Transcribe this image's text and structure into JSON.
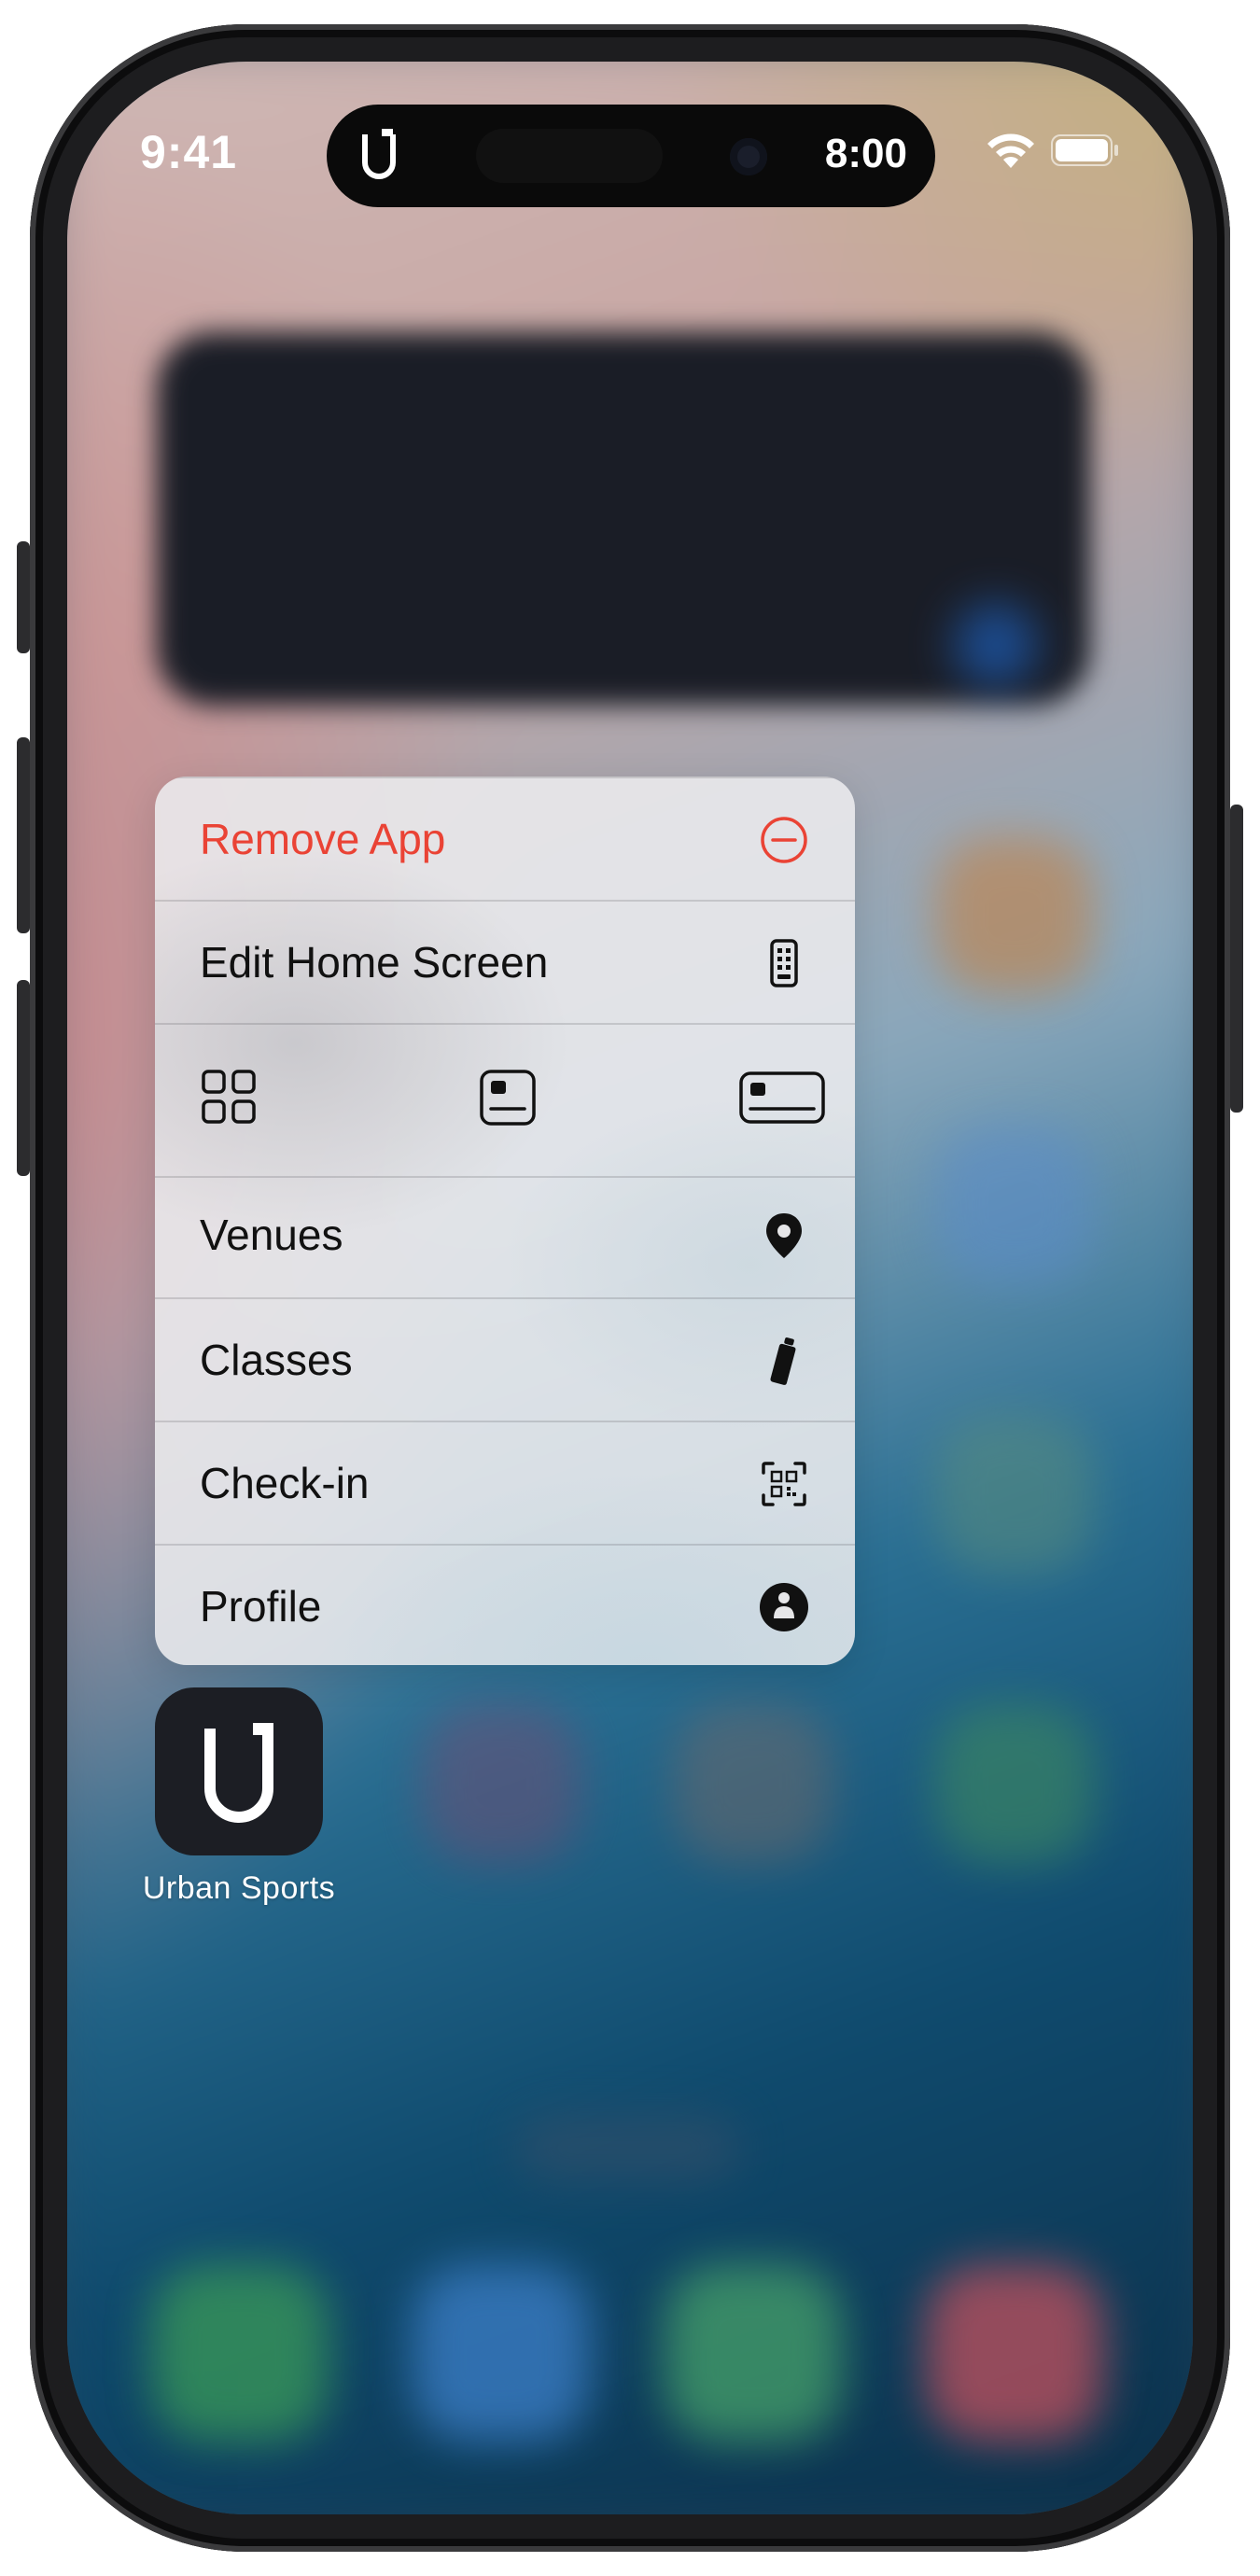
{
  "status_bar": {
    "time": "9:41",
    "live_activity_time": "8:00"
  },
  "context_menu": {
    "remove": {
      "label": "Remove App",
      "color": "#ea4335"
    },
    "edit": {
      "label": "Edit Home Screen"
    },
    "widget_sizes": [
      "small-widget-icon",
      "medium-widget-icon",
      "large-widget-icon"
    ],
    "shortcuts": [
      {
        "label": "Venues",
        "icon": "location-pin-icon"
      },
      {
        "label": "Classes",
        "icon": "bottle-icon"
      },
      {
        "label": "Check-in",
        "icon": "qr-code-icon"
      },
      {
        "label": "Profile",
        "icon": "person-icon"
      }
    ]
  },
  "app": {
    "name": "Urban Sports",
    "icon_bg": "#1c1e24"
  }
}
